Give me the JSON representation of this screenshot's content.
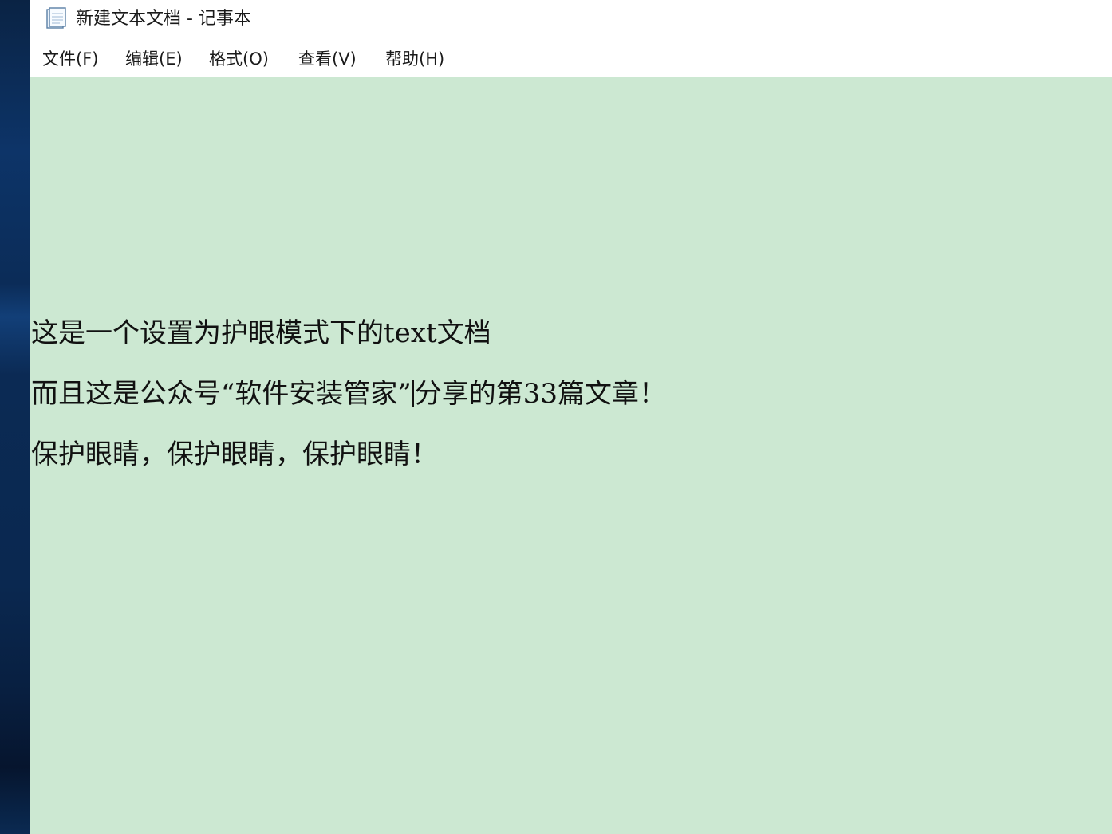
{
  "window": {
    "title": "新建文本文档 - 记事本",
    "icon": "notepad-icon"
  },
  "menu": {
    "items": [
      {
        "label": "文件(F)"
      },
      {
        "label": "编辑(E)"
      },
      {
        "label": "格式(O)"
      },
      {
        "label": "查看(V)"
      },
      {
        "label": "帮助(H)"
      }
    ]
  },
  "editor": {
    "background_color": "#cce8d2",
    "lines": [
      {
        "text": "这是一个设置为护眼模式下的text文档"
      },
      {
        "text_before_caret": "而且这是公众号“软件安装管家”",
        "text_after_caret": "分享的第33篇文章！"
      },
      {
        "text": "保护眼睛，保护眼睛，保护眼睛！"
      }
    ]
  }
}
